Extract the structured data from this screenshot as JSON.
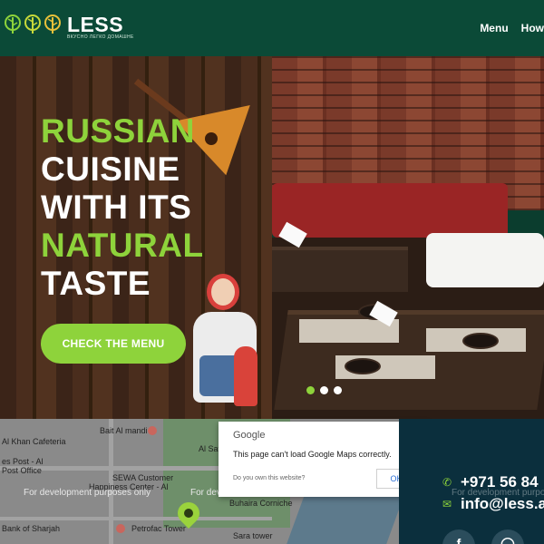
{
  "header": {
    "brand": "LESS",
    "brand_subtitle": "ВКУСНО ЛЕГКО ДОМАШНЕ",
    "nav": [
      "Menu",
      "How"
    ]
  },
  "hero": {
    "headline": [
      {
        "text": "RUSSIAN",
        "color": "green"
      },
      {
        "text": "CUISINE",
        "color": "white"
      },
      {
        "text": "WITH ITS",
        "color": "white"
      },
      {
        "text": "NATURAL",
        "color": "green"
      },
      {
        "text": "TASTE",
        "color": "white"
      }
    ],
    "cta_label": "CHECK THE MENU",
    "slides": 3,
    "active_slide": 1
  },
  "map": {
    "labels": {
      "bait_al_mandi": "Bait Al mandi",
      "al_khan": "Al Khan Cafeteria",
      "post": "es Post - Al",
      "post_office": "Post Office",
      "sewa": "SEWA Customer",
      "sewa2": "Happiness Center - Al",
      "al_safa": "Al Safa",
      "buhaira": "Buhaira Corniche",
      "bank": "Bank of Sharjah",
      "petrofac": "Petrofac Tower",
      "sara": "Sara tower",
      "wm1": "For development purposes only",
      "wm2": "For development"
    }
  },
  "google_dialog": {
    "title": "Google",
    "message": "This page can't load Google Maps correctly.",
    "own_link": "Do you own this website?",
    "ok_label": "OK"
  },
  "contact": {
    "phone": "+971 56 84",
    "email": "info@less.a",
    "watermark": "For development purpo"
  },
  "colors": {
    "header_bg": "#0b4a37",
    "accent_green": "#8ed33b",
    "contact_bg": "#0b2f3d"
  }
}
